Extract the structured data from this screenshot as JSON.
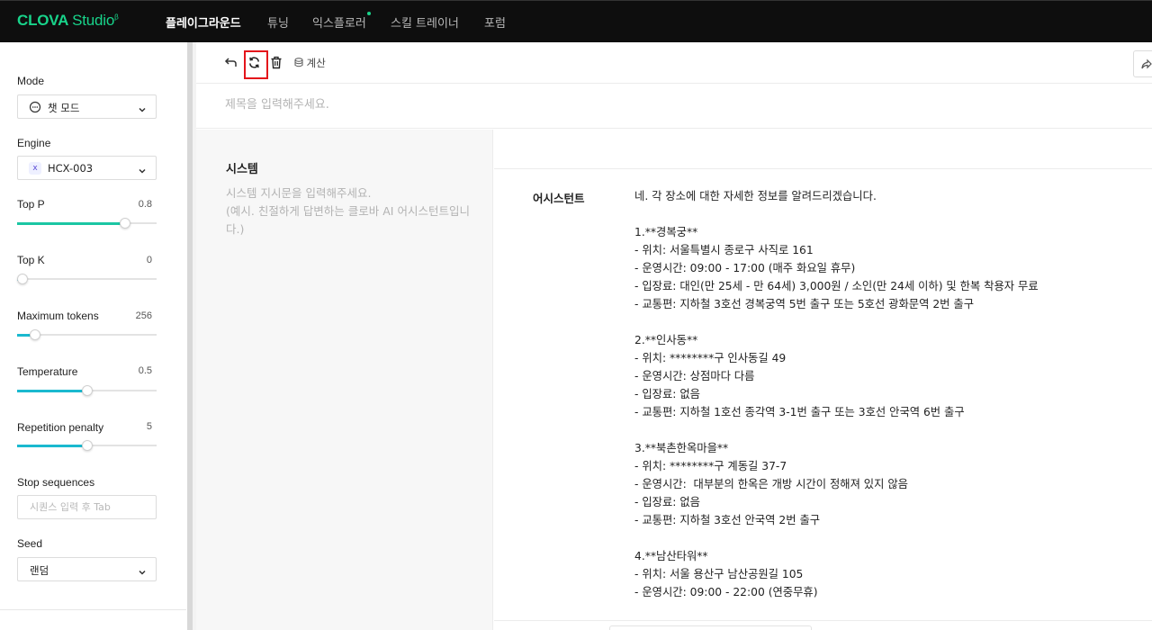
{
  "app": {
    "logo_main": "CLOVA",
    "logo_sub": "Studio",
    "logo_sup": "β"
  },
  "nav": [
    {
      "label": "플레이그라운드",
      "active": true
    },
    {
      "label": "튜닝",
      "active": false
    },
    {
      "label": "익스플로러",
      "active": false,
      "badge_dot": true
    },
    {
      "label": "스킬 트레이너",
      "active": false
    },
    {
      "label": "포럼",
      "active": false
    }
  ],
  "sidebar": {
    "mode": {
      "label": "Mode",
      "value": "챗 모드",
      "icon": "chat-bubble-icon"
    },
    "engine": {
      "label": "Engine",
      "value": "HCX-003",
      "icon": "x-engine-icon"
    },
    "top_p": {
      "label": "Top P",
      "value": "0.8",
      "fraction": 0.8
    },
    "top_k": {
      "label": "Top K",
      "value": "0",
      "fraction": 0.0
    },
    "max_tokens": {
      "label": "Maximum tokens",
      "value": "256",
      "fraction": 0.1
    },
    "temperature": {
      "label": "Temperature",
      "value": "0.5",
      "fraction": 0.5
    },
    "repetition_penalty": {
      "label": "Repetition penalty",
      "value": "5",
      "fraction": 0.5
    },
    "stop_sequences": {
      "label": "Stop sequences",
      "placeholder": "시퀀스 입력 후 Tab"
    },
    "seed": {
      "label": "Seed",
      "value": "랜덤"
    }
  },
  "toolbar": {
    "undo_icon": "undo-arrow-icon",
    "refresh_icon": "refresh-icon",
    "delete_icon": "trash-icon",
    "calc_label": "계산",
    "share_icon": "share-icon"
  },
  "title": {
    "placeholder": "제목을 입력해주세요."
  },
  "system": {
    "title": "시스템",
    "placeholder": "시스템 지시문을 입력해주세요.\n(예시. 친절하게 답변하는 클로바 AI 어시스턴트입니다.)"
  },
  "chat": {
    "role": "어시스턴트",
    "lines": [
      "네. 각 장소에 대한 자세한 정보를 알려드리겠습니다.",
      "",
      "1.**경복궁**",
      "- 위치: 서울특별시 종로구 사직로 161",
      "- 운영시간: 09:00 - 17:00 (매주 화요일 휴무)",
      "- 입장료: 대인(만 25세 - 만 64세) 3,000원 / 소인(만 24세 이하) 및 한복 착용자 무료",
      "- 교통편: 지하철 3호선 경복궁역 5번 출구 또는 5호선 광화문역 2번 출구",
      "",
      "2.**인사동**",
      "- 위치: ********구 인사동길 49",
      "- 운영시간: 상점마다 다름",
      "- 입장료: 없음",
      "- 교통편: 지하철 1호선 종각역 3-1번 출구 또는 3호선 안국역 6번 출구",
      "",
      "3.**북촌한옥마을**",
      "- 위치: ********구 계동길 37-7",
      "- 운영시간:  대부분의 한옥은 개방 시간이 정해져 있지 않음",
      "- 입장료: 없음",
      "- 교통편: 지하철 3호선 안국역 2번 출구",
      "",
      "4.**남산타워**",
      "- 위치: 서울 용산구 남산공원길 105",
      "- 운영시간: 09:00 - 22:00 (연중무휴)"
    ]
  },
  "colors": {
    "topbar": "#0e0e0e",
    "brand": "#18d38a",
    "slider_fill": "#1ab9cf",
    "highlight": "#e4141b"
  }
}
